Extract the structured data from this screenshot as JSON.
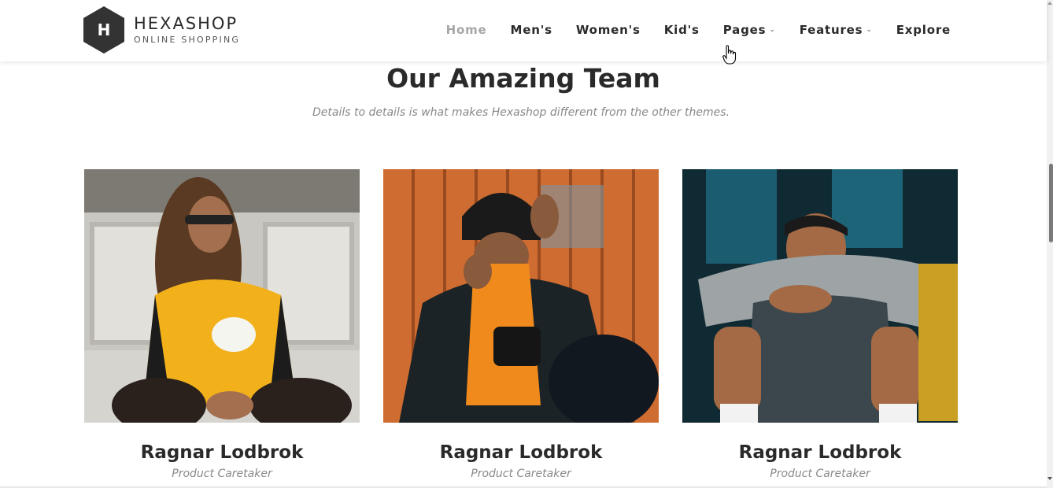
{
  "brand": {
    "letter": "H",
    "title": "HEXASHOP",
    "subtitle": "ONLINE SHOPPING",
    "color": "#3a3a3a"
  },
  "nav": [
    {
      "label": "Home",
      "active": true
    },
    {
      "label": "Men's"
    },
    {
      "label": "Women's"
    },
    {
      "label": "Kid's"
    },
    {
      "label": "Pages",
      "dropdown": true
    },
    {
      "label": "Features",
      "dropdown": true
    },
    {
      "label": "Explore"
    }
  ],
  "section": {
    "title": "Our Amazing Team",
    "subtitle": "Details to details is what makes Hexashop different from the other themes."
  },
  "team": [
    {
      "name": "Ragnar Lodbrok",
      "role": "Product Caretaker"
    },
    {
      "name": "Ragnar Lodbrok",
      "role": "Product Caretaker"
    },
    {
      "name": "Ragnar Lodbrok",
      "role": "Product Caretaker"
    }
  ],
  "colors": {
    "text": "#2a2a2a",
    "muted": "#888888",
    "nav_active": "#a6a6a6"
  }
}
